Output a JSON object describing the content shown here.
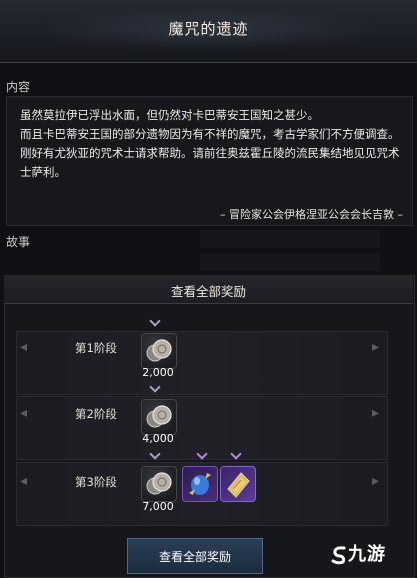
{
  "window": {
    "title": "魔咒的遗迹"
  },
  "content": {
    "label": "内容",
    "paragraphs": [
      "虽然莫拉伊已浮出水面，但仍然对卡巴蒂安王国知之甚少。",
      "而且卡巴蒂安王国的部分遗物因为有不祥的魔咒，考古学家们不方便调查。",
      "刚好有尤狄亚的咒术士请求帮助。请前往奥兹霍丘陵的流民集结地见见咒术士萨利。"
    ],
    "signature": "– 冒险家公会伊格涅亚公会会长吉敦 –"
  },
  "story": {
    "label": "故事"
  },
  "rewards": {
    "header": "查看全部奖励",
    "stages": [
      {
        "label": "第1阶段",
        "items": [
          {
            "icon": "silver-coin-icon",
            "quantity": "2,000"
          }
        ]
      },
      {
        "label": "第2阶段",
        "items": [
          {
            "icon": "silver-coin-icon",
            "quantity": "4,000"
          }
        ]
      },
      {
        "label": "第3阶段",
        "items": [
          {
            "icon": "silver-coin-icon",
            "quantity": "7,000"
          },
          {
            "icon": "blue-orb-icon",
            "quantity": ""
          },
          {
            "icon": "purple-tome-icon",
            "quantity": ""
          }
        ]
      }
    ],
    "button_label": "查看全部奖励"
  },
  "watermark": {
    "text": "九游"
  },
  "colors": {
    "accent_purple": "#b88ad8",
    "button_blue": "#2a3e55"
  }
}
